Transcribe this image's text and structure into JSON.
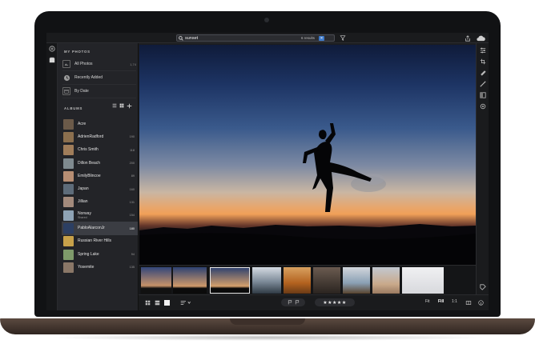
{
  "search": {
    "query": "sunset",
    "results_label": "6 results"
  },
  "sidebar": {
    "my_photos_title": "MY PHOTOS",
    "my_photos": [
      {
        "label": "All Photos",
        "count": "1,74"
      },
      {
        "label": "Recently Added",
        "count": ""
      },
      {
        "label": "By Date",
        "count": ""
      }
    ],
    "albums_title": "ALBUMS",
    "albums": [
      {
        "label": "Acre",
        "sub": "",
        "count": "",
        "color": "#6b5a49"
      },
      {
        "label": "AdrienRadford",
        "sub": "",
        "count": "190",
        "color": "#8b6f4e"
      },
      {
        "label": "Chris Smith",
        "sub": "",
        "count": "118",
        "color": "#a07d5a"
      },
      {
        "label": "Dillon Beach",
        "sub": "",
        "count": "200",
        "color": "#7f8a8f"
      },
      {
        "label": "EmilyBlincoe",
        "sub": "",
        "count": "89",
        "color": "#b78e73"
      },
      {
        "label": "Japan",
        "sub": "",
        "count": "160",
        "color": "#5e6c7a"
      },
      {
        "label": "Jillian",
        "sub": "",
        "count": "131",
        "color": "#a38a7c"
      },
      {
        "label": "Norway",
        "sub": "Shared",
        "count": "154",
        "color": "#8ea3b5"
      },
      {
        "label": "PabloAlarconJr",
        "sub": "",
        "count": "180",
        "color": "#2c3f63"
      },
      {
        "label": "Russian River Hills",
        "sub": "",
        "count": "",
        "color": "#c7a14a"
      },
      {
        "label": "Spring Lake",
        "sub": "",
        "count": "94",
        "color": "#7e9a6a"
      },
      {
        "label": "Yosemite",
        "sub": "",
        "count": "135",
        "color": "#8a7767"
      }
    ],
    "selected_album": "PabloAlarconJr"
  },
  "filmstrip": [
    {
      "name": "thumb-1",
      "tone": "dusk"
    },
    {
      "name": "thumb-2",
      "tone": "dusk-kick"
    },
    {
      "name": "thumb-3",
      "tone": "dusk-kick-selected"
    },
    {
      "name": "thumb-4",
      "tone": "coast"
    },
    {
      "name": "thumb-5",
      "tone": "autumn"
    },
    {
      "name": "thumb-6",
      "tone": "portrait"
    },
    {
      "name": "thumb-7",
      "tone": "beach"
    },
    {
      "name": "thumb-8",
      "tone": "sand"
    },
    {
      "name": "thumb-9",
      "tone": "bright"
    }
  ],
  "bottom_bar": {
    "stars": "★★★★★",
    "fit": "Fit",
    "fill": "Fill",
    "one_to_one": "1:1"
  },
  "colors": {
    "accent": "#3d79c9",
    "panel": "#232428",
    "selected_row": "#3b3d43"
  },
  "tools": [
    "sliders-icon",
    "crop-rotate-icon",
    "healing-brush-icon",
    "brush-icon",
    "gradient-icon",
    "radial-icon"
  ]
}
